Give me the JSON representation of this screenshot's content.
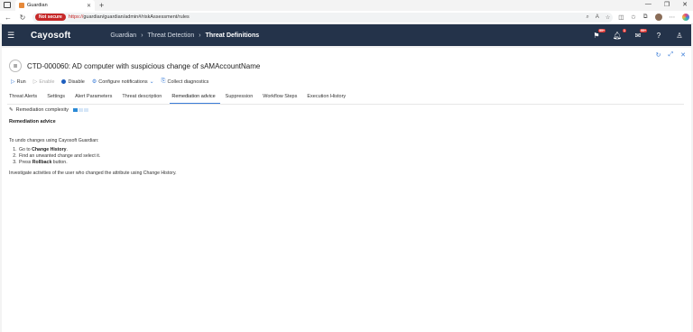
{
  "browser": {
    "tab_title": "Guardian",
    "not_secure_label": "Not secure",
    "url_scheme": "https://",
    "url_rest": "guardian/guardian/admin#/riskAssessment/rules"
  },
  "app": {
    "logo": "Cayosoft",
    "breadcrumbs": [
      "Guardian",
      "Threat Detection",
      "Threat Definitions"
    ],
    "header_badges": [
      "99+",
      "1",
      "99+"
    ]
  },
  "rule": {
    "title": "CTD-000060: AD computer with suspicious change of sAMAccountName"
  },
  "actions": {
    "run": "Run",
    "enable": "Enable",
    "disable": "Disable",
    "configure_notifications": "Configure notifications",
    "collect_diagnostics": "Collect diagnostics"
  },
  "tabs": [
    "Threat Alerts",
    "Settings",
    "Alert Parameters",
    "Threat description",
    "Remediation advice",
    "Suppression",
    "Workflow Steps",
    "Execution History"
  ],
  "active_tab": "Remediation advice",
  "complexity": {
    "label": "Remediation complexity",
    "level": 1,
    "max": 3
  },
  "advice": {
    "heading": "Remediation advice",
    "intro": "To undo changes using Cayosoft Guardian:",
    "step1_prefix": "Go to ",
    "step1_bold": "Change History",
    "step1_suffix": ".",
    "step2": "Find an unwanted change and select it.",
    "step3_prefix": "Press ",
    "step3_bold": "Rollback",
    "step3_suffix": " button.",
    "footer": "Investigate activities of the user who changed the attribute using Change History."
  },
  "colors": {
    "header_bg": "#24334a",
    "accent": "#3b7dd8",
    "danger": "#c62828"
  }
}
